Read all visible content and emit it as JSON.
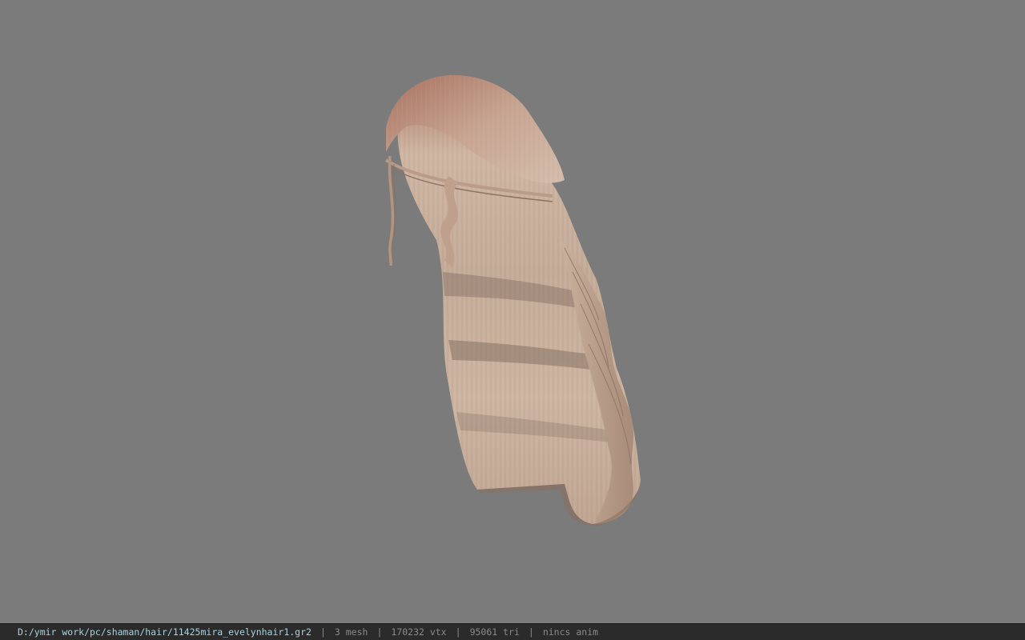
{
  "status_bar": {
    "file_path": "D:/ymir work/pc/shaman/hair/11425mira_evelynhair1.gr2",
    "separator": "|",
    "mesh_count": "3 mesh",
    "vertex_count": "170232 vtx",
    "triangle_count": "95061 tri",
    "animation": "nincs anim"
  },
  "viewport": {
    "background_color": "#7b7b7b",
    "model_subject": "long-wavy-hair-mesh",
    "hair_base_color": "#c9ad97",
    "hair_root_color": "#b88a78"
  }
}
